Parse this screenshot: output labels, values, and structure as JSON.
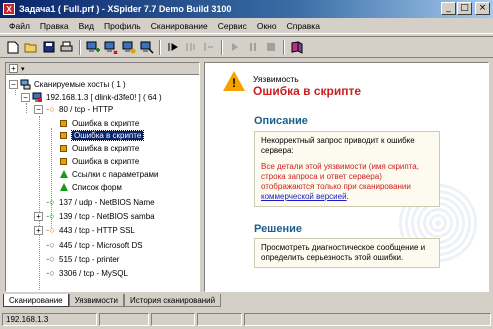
{
  "window": {
    "title": "Задача1 ( Full.prf ) - XSpider 7.7 Demo Build 3100",
    "minimize": "_",
    "maximize": "□",
    "close": "×"
  },
  "menu": [
    "Файл",
    "Правка",
    "Вид",
    "Профиль",
    "Сканирование",
    "Сервис",
    "Окно",
    "Справка"
  ],
  "toolbar": {
    "icons": [
      "new-file-icon",
      "open-folder-icon",
      "save-icon",
      "print-icon",
      "add-host-icon",
      "remove-host-icon",
      "scan-host-icon",
      "scan-all-icon",
      "step-into-icon",
      "step-over-icon",
      "step-out-icon",
      "play-icon",
      "pause-icon",
      "stop-icon",
      "help-book-icon"
    ]
  },
  "tree": {
    "header_plus": "+",
    "header_arrow": "▾",
    "root": "Сканируемые хосты ( 1 )",
    "host": "192.168.1.3 [ dlink-d3fe0! ] ( 64 )",
    "port_http": "80 / tcp - HTTP",
    "vulns": [
      "Ошибка в скрипте",
      "Ошибка в скрипте",
      "Ошибка в скрипте",
      "Ошибка в скрипте"
    ],
    "param_links": "Ссылки с параметрами",
    "form_list": "Список форм",
    "ports": [
      {
        "label": "137 / udp - NetBIOS Name",
        "color": "green",
        "exp": false
      },
      {
        "label": "139 / tcp - NetBIOS samba",
        "color": "green",
        "exp": true
      },
      {
        "label": "443 / tcp - HTTP SSL",
        "color": "orange",
        "exp": true
      },
      {
        "label": "445 / tcp - Microsoft DS",
        "color": "gray",
        "exp": false
      },
      {
        "label": "515 / tcp - printer",
        "color": "gray",
        "exp": false
      },
      {
        "label": "3306 / tcp - MySQL",
        "color": "gray",
        "exp": false
      }
    ]
  },
  "detail": {
    "kind": "Уязвимость",
    "title": "Ошибка в скрипте",
    "desc_heading": "Описание",
    "desc_text": "Некорректный запрос приводит к ошибке сервера:",
    "desc_red": "Все детали этой уязвимости (имя скрипта, строка запроса и ответ сервера) отображаются только при сканировании",
    "desc_link": "коммерческой версией",
    "desc_end": ".",
    "solution_heading": "Решение",
    "solution_text": "Просмотреть диагностическое сообщение и определить серьезность этой ошибки."
  },
  "tabs": [
    "Сканирование",
    "Уязвимости",
    "История сканирований"
  ],
  "status": {
    "host": "192.168.1.3"
  },
  "colors": {
    "accent_red": "#cc1f1f",
    "heading_blue": "#1a5f8a",
    "title_bar": "#0a246a"
  }
}
